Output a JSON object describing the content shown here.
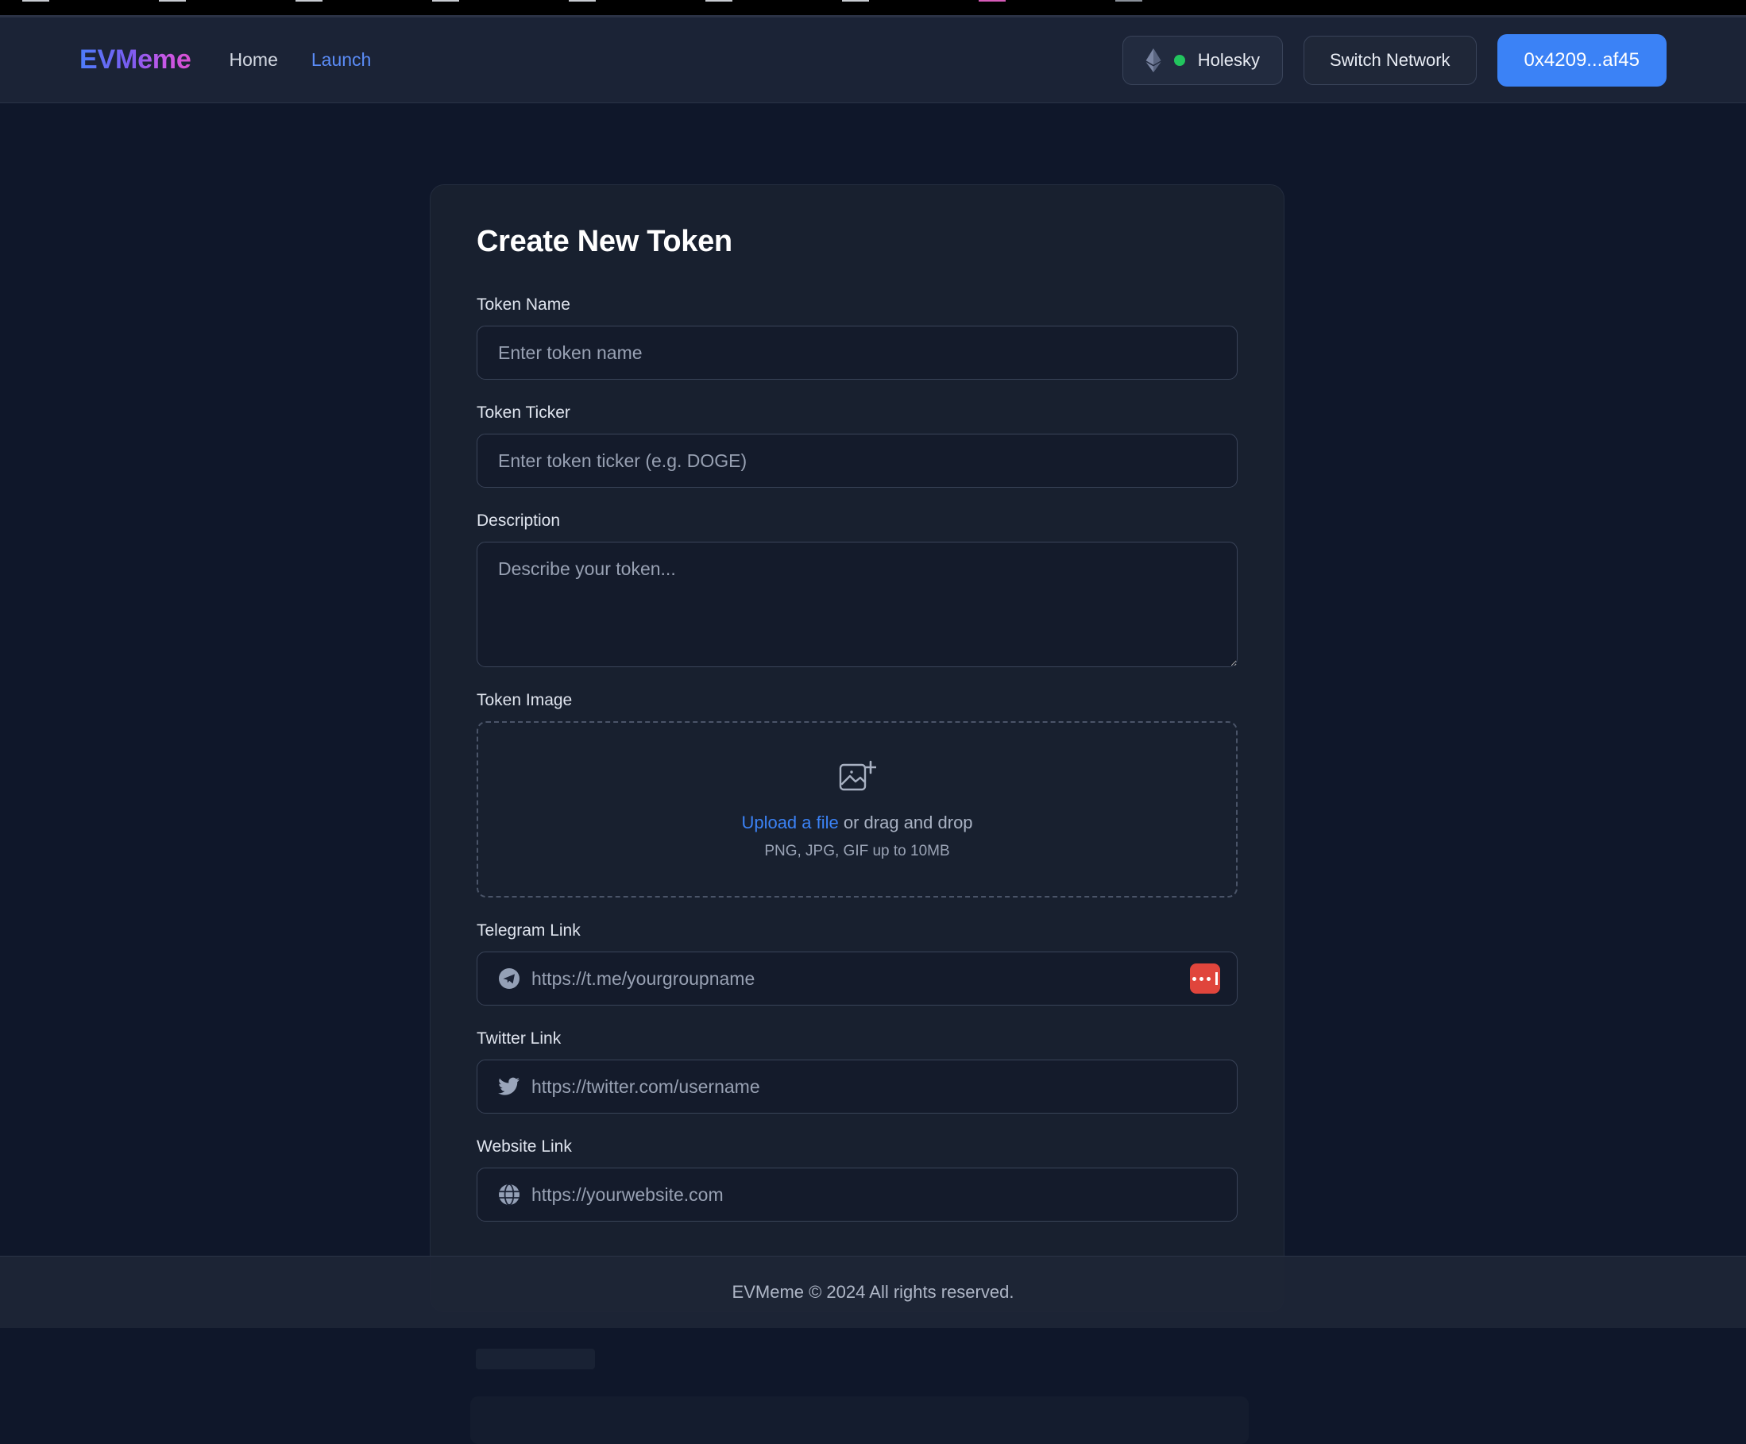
{
  "browser": {
    "tabs_visible": 10
  },
  "navbar": {
    "brand": "EVMeme",
    "links": [
      {
        "label": "Home",
        "accent": false
      },
      {
        "label": "Launch",
        "accent": true
      }
    ],
    "network_chip": {
      "icon": "ethereum-icon",
      "status_dot": "online-dot",
      "label": "Holesky",
      "status_color": "#22c55e"
    },
    "switch_network_label": "Switch Network",
    "address_label": "0x4209...af45",
    "address_button_color": "#3b82f6"
  },
  "form": {
    "title": "Create New Token",
    "fields": {
      "token_name": {
        "label": "Token Name",
        "placeholder": "Enter token name",
        "value": ""
      },
      "token_ticker": {
        "label": "Token Ticker",
        "placeholder": "Enter token ticker (e.g. DOGE)",
        "value": ""
      },
      "description": {
        "label": "Description",
        "placeholder": "Describe your token...",
        "value": ""
      },
      "token_image": {
        "label": "Token Image",
        "upload_link": "Upload a file",
        "drag_text": " or drag and drop",
        "hint": "PNG, JPG, GIF up to 10MB",
        "icon": "image-add-icon"
      },
      "telegram": {
        "label": "Telegram Link",
        "placeholder": "https://t.me/yourgroupname",
        "value": "",
        "icon": "telegram-icon",
        "badge": "password-manager-icon",
        "badge_color": "#e0453c"
      },
      "twitter": {
        "label": "Twitter Link",
        "placeholder": "https://twitter.com/username",
        "value": "",
        "icon": "twitter-icon"
      },
      "website": {
        "label": "Website Link",
        "placeholder": "https://yourwebsite.com",
        "value": "",
        "icon": "globe-icon"
      }
    }
  },
  "footer": {
    "text": "EVMeme © 2024 All rights reserved."
  },
  "theme": {
    "page_bg": "#0f172a",
    "card_bg": "#18202f",
    "navbar_bg": "#1b2336",
    "footer_bg": "#1e2536",
    "input_bg": "#141b2b",
    "accent_blue": "#3b82f6",
    "link_blue": "#5b8cf7"
  }
}
